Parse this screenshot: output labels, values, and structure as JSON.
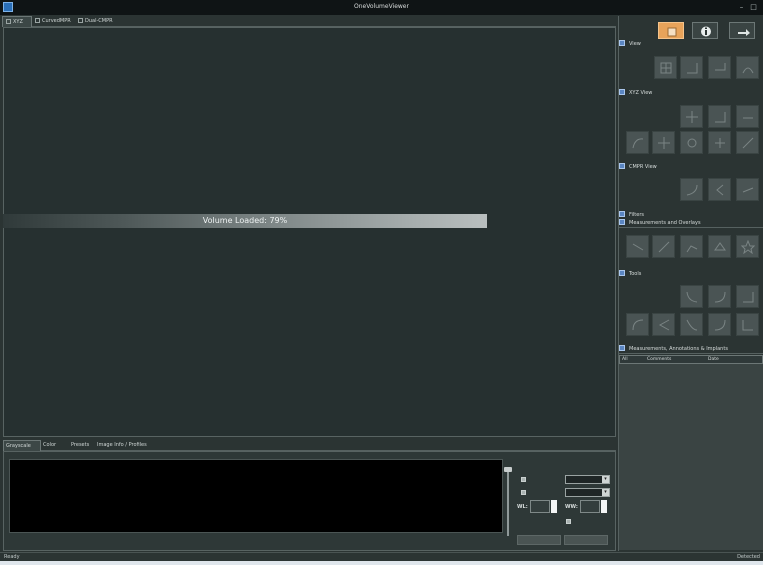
{
  "window": {
    "title": "OneVolumeViewer",
    "minimize": "–",
    "maximize": "□"
  },
  "view_tabs": [
    {
      "label": "XYZ"
    },
    {
      "label": "CurvedMPR"
    },
    {
      "label": "Dual-CMPR"
    }
  ],
  "viewport": {
    "progress_text": "Volume Loaded: 79%",
    "progress_percent": 79
  },
  "bottom_tabs": [
    {
      "label": "Grayscale"
    },
    {
      "label": "Color"
    },
    {
      "label": "Presets"
    },
    {
      "label": "Image Info / Profiles"
    }
  ],
  "window_level": {
    "wl_label": "WL:",
    "ww_label": "WW:"
  },
  "right_panel": {
    "sections": {
      "view": "View",
      "xyz_view": "XYZ View",
      "cmpr_view": "CMPR View",
      "filters": "Filters",
      "measurements_overlays": "Measurements and Overlays",
      "tools": "Tools",
      "annotations": "Measurements, Annotations & Implants"
    },
    "annotation_table": {
      "columns": [
        "All",
        "Comments",
        "Date"
      ]
    }
  },
  "status": {
    "left": "Ready",
    "right": "Detected"
  },
  "colors": {
    "accent": "#e8a35a",
    "section_icon": "#5b86c2",
    "background": "#2b3433"
  }
}
